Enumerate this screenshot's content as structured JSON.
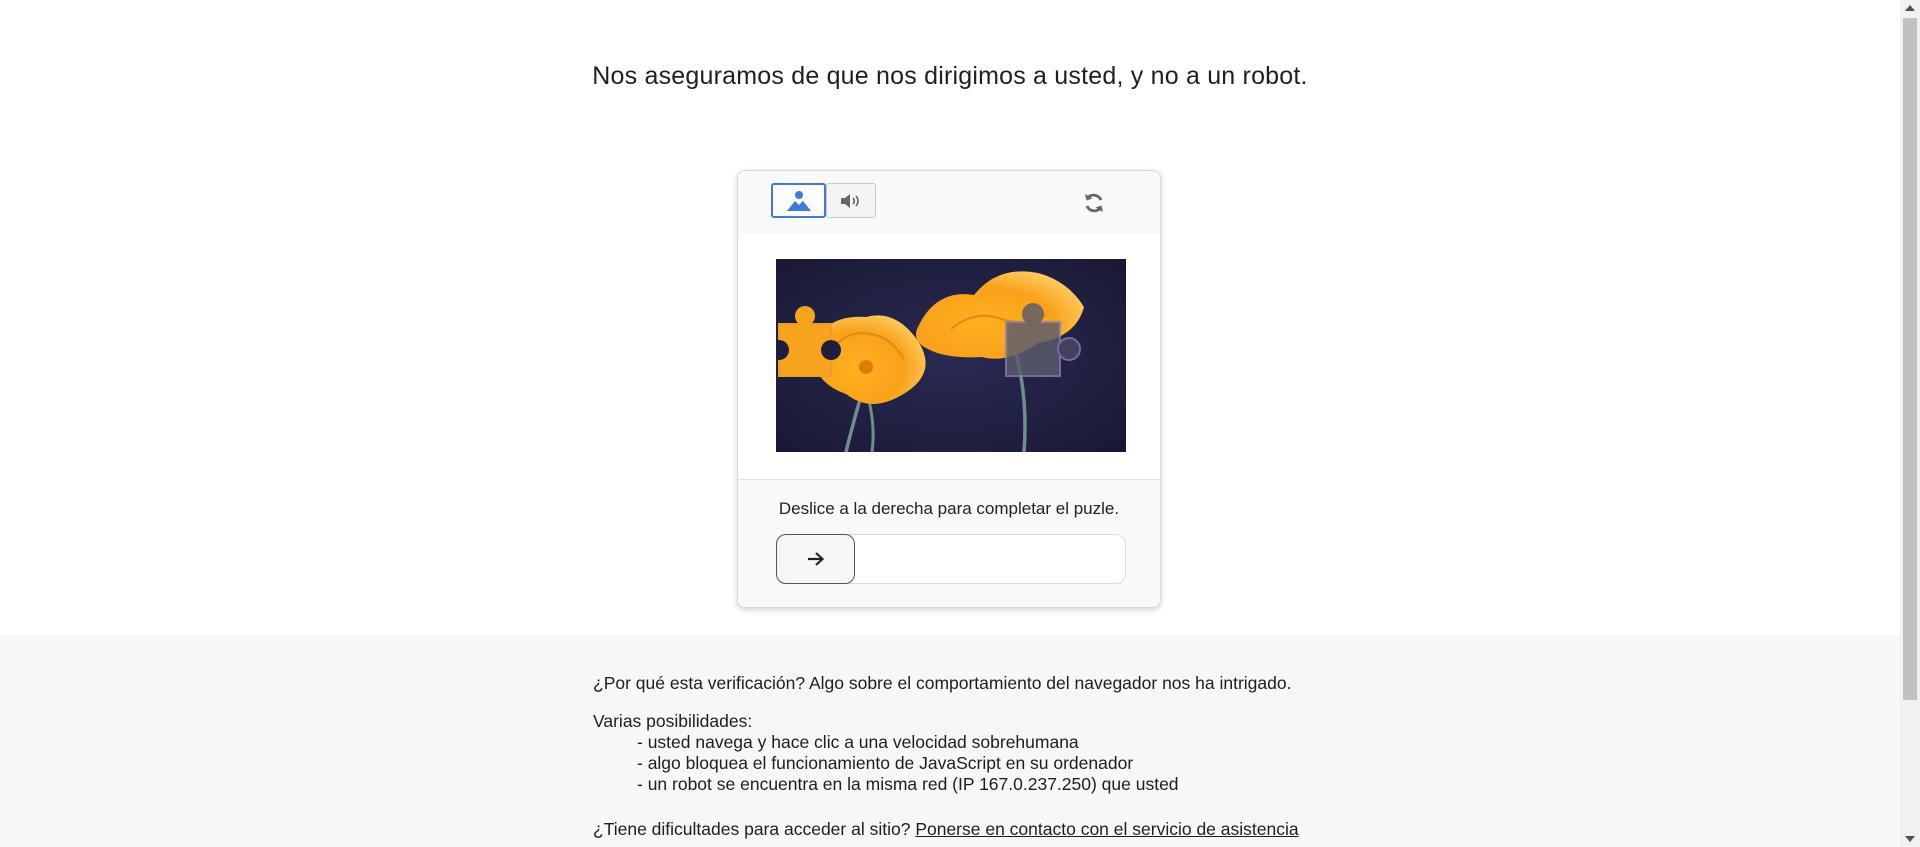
{
  "headline": "Nos aseguramos de que nos dirigimos a usted, y no a un robot.",
  "captcha": {
    "modes": [
      {
        "name": "image",
        "icon": "person-image-icon",
        "selected": true
      },
      {
        "name": "audio",
        "icon": "speaker-icon",
        "selected": false
      }
    ],
    "refresh_icon": "refresh-icon",
    "instruction": "Deslice a la derecha para completar el puzle.",
    "slider_icon": "arrow-right-icon",
    "slider_progress": 0,
    "colors": {
      "accent": "#3d7bd9",
      "image_background": "#1f1f3d",
      "flower": "#f7a51c"
    }
  },
  "info": {
    "why": "¿Por qué esta verificación? Algo sobre el comportamiento del navegador nos ha intrigado.",
    "possibilities_title": "Varias posibilidades:",
    "possibilities": [
      "- usted navega y hace clic a una velocidad sobrehumana",
      "- algo bloquea el funcionamiento de JavaScript en su ordenador",
      "- un robot se encuentra en la misma red (IP 167.0.237.250) que usted"
    ],
    "help_prefix": "¿Tiene dificultades para acceder al sitio?",
    "help_link": "Ponerse en contacto con el servicio de asistencia"
  }
}
